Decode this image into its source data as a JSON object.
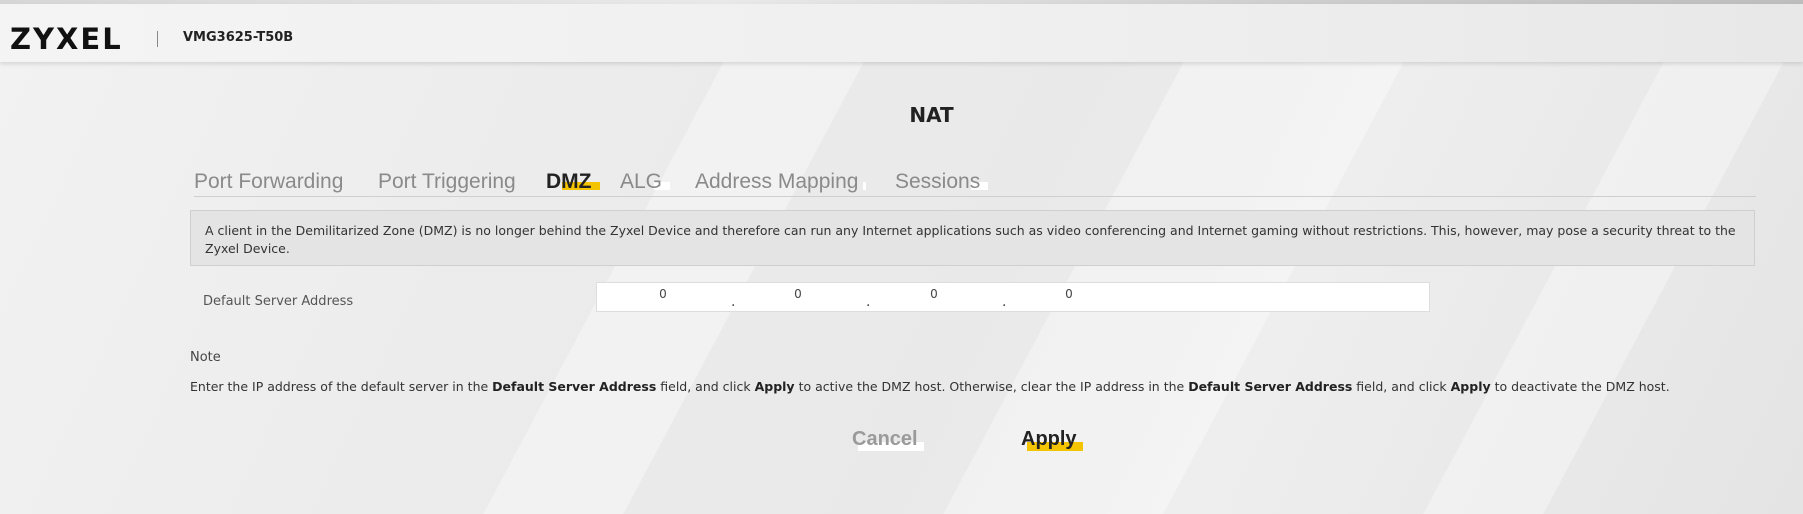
{
  "header": {
    "logo": "ZYXEL",
    "model": "VMG3625-T50B"
  },
  "page": {
    "title": "NAT"
  },
  "tabs": [
    {
      "label": "Port Forwarding",
      "active": false
    },
    {
      "label": "Port Triggering",
      "active": false
    },
    {
      "label": "DMZ",
      "active": true
    },
    {
      "label": "ALG",
      "active": false
    },
    {
      "label": "Address Mapping",
      "active": false
    },
    {
      "label": "Sessions",
      "active": false
    }
  ],
  "info": {
    "text": "A client in the Demilitarized Zone (DMZ) is no longer behind the Zyxel Device and therefore can run any Internet applications such as video conferencing and Internet gaming without restrictions. This, however, may pose a security threat to the Zyxel Device."
  },
  "form": {
    "default_server_label": "Default Server Address",
    "octets": [
      "0",
      "0",
      "0",
      "0"
    ],
    "separator": "."
  },
  "note": {
    "title": "Note",
    "part1": "Enter the IP address of the default server in the ",
    "bold1": "Default Server Address",
    "part2": " field, and click ",
    "bold2": "Apply",
    "part3": " to active the DMZ host. Otherwise, clear the IP address in the ",
    "bold3": "Default Server Address",
    "part4": " field, and click ",
    "bold4": "Apply",
    "part5": " to deactivate the DMZ host."
  },
  "buttons": {
    "cancel": "Cancel",
    "apply": "Apply"
  },
  "colors": {
    "accent": "#f5c400",
    "inactive_tab": "#8a8a8a"
  }
}
